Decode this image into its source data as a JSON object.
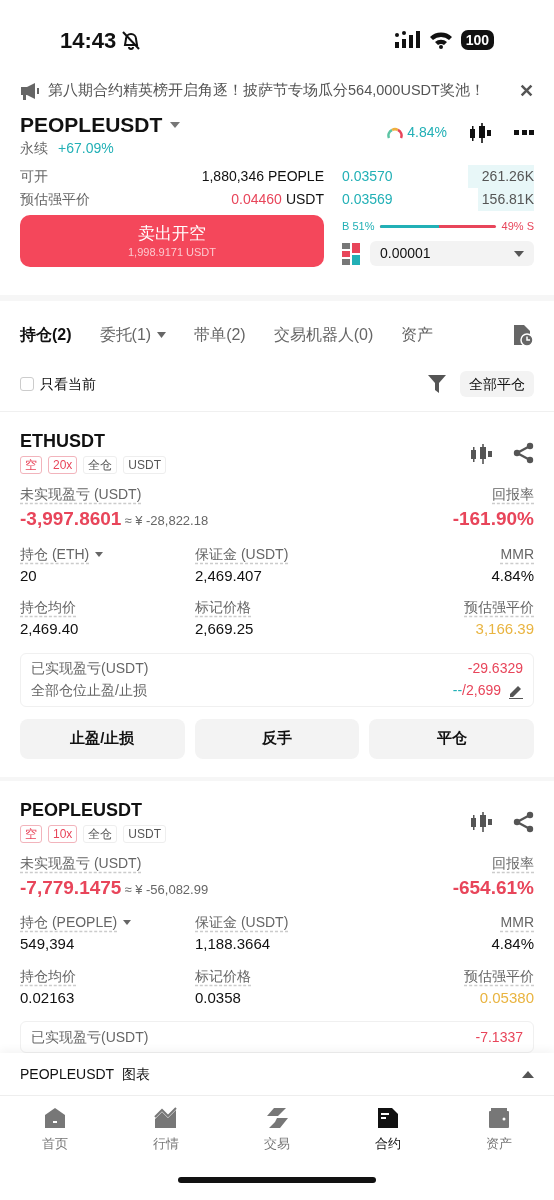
{
  "status_bar": {
    "time": "14:43",
    "battery": "100"
  },
  "banner": {
    "text": "第八期合约精英榜开启角逐！披萨节专场瓜分564,000USDT奖池！",
    "close": "✕"
  },
  "header": {
    "symbol": "PEOPLEUSDT",
    "type": "永续",
    "change": "+67.09%",
    "mmr": "4.84%"
  },
  "order_form": {
    "rows": [
      {
        "label": "可开",
        "value": "1,880,346",
        "unit": "PEOPLE",
        "color": "#111111"
      },
      {
        "label": "预估强平价",
        "value": "0.04460",
        "unit": "USDT",
        "color": "#e8455a"
      }
    ],
    "button": {
      "label": "卖出开空",
      "sub": "1,998.9171 USDT"
    }
  },
  "order_book": {
    "asks": [
      {
        "price": "0.03570",
        "amount": "261.26K"
      },
      {
        "price": "0.03569",
        "amount": "156.81K"
      }
    ],
    "buy_label": "B 51%",
    "sell_label": "49% S",
    "ratio": {
      "level": 0.51
    },
    "precision": "0.00001"
  },
  "tabs": [
    {
      "label": "持仓(2)",
      "selected": true,
      "dropdown": false
    },
    {
      "label": "委托(1)",
      "selected": false,
      "dropdown": true
    },
    {
      "label": "带单(2)",
      "selected": false,
      "dropdown": false
    },
    {
      "label": "交易机器人(0)",
      "selected": false,
      "dropdown": false
    },
    {
      "label": "资产",
      "selected": false,
      "dropdown": false
    }
  ],
  "filter": {
    "label": "只看当前",
    "checked": false,
    "close_all": "全部平仓"
  },
  "positions": [
    {
      "symbol": "ETHUSDT",
      "tags": [
        {
          "text": "空",
          "kind": "side"
        },
        {
          "text": "20x",
          "kind": "leverage"
        },
        {
          "text": "全仓",
          "kind": "plain"
        },
        {
          "text": "USDT",
          "kind": "plain"
        }
      ],
      "pnl_label": "未实现盈亏 (USDT)",
      "pnl": "-3,997.8601",
      "pnl_cny": "≈ ¥ -28,822.18",
      "roe_label": "回报率",
      "roe": "-161.90%",
      "fields": [
        {
          "label": "持仓 (ETH)",
          "value": "20",
          "color": "#111111",
          "dropdown": true
        },
        {
          "label": "保证金 (USDT)",
          "value": "2,469.407",
          "color": "#111111",
          "dropdown": false
        },
        {
          "label": "MMR",
          "value": "4.84%",
          "color": "#111111",
          "dropdown": false
        },
        {
          "label": "持仓均价",
          "value": "2,469.40",
          "color": "#111111",
          "dropdown": false
        },
        {
          "label": "标记价格",
          "value": "2,669.25",
          "color": "#111111",
          "dropdown": false
        },
        {
          "label": "预估强平价",
          "value": "3,166.39",
          "color": "#e9b440",
          "dropdown": false
        }
      ],
      "summary": [
        {
          "label": "已实现盈亏(USDT)",
          "parts": [
            {
              "text": "-29.6329",
              "color": "#e8455a"
            }
          ],
          "editable": false
        },
        {
          "label": "全部仓位止盈/止损",
          "parts": [
            {
              "text": "--",
              "color": "#22b0b6"
            },
            {
              "text": "/2,699",
              "color": "#e8455a"
            }
          ],
          "editable": true
        }
      ],
      "buttons": [
        "止盈/止损",
        "反手",
        "平仓"
      ]
    },
    {
      "symbol": "PEOPLEUSDT",
      "tags": [
        {
          "text": "空",
          "kind": "side"
        },
        {
          "text": "10x",
          "kind": "leverage"
        },
        {
          "text": "全仓",
          "kind": "plain"
        },
        {
          "text": "USDT",
          "kind": "plain"
        }
      ],
      "pnl_label": "未实现盈亏 (USDT)",
      "pnl": "-7,779.1475",
      "pnl_cny": "≈ ¥ -56,082.99",
      "roe_label": "回报率",
      "roe": "-654.61%",
      "fields": [
        {
          "label": "持仓 (PEOPLE)",
          "value": "549,394",
          "color": "#111111",
          "dropdown": true
        },
        {
          "label": "保证金 (USDT)",
          "value": "1,188.3664",
          "color": "#111111",
          "dropdown": false
        },
        {
          "label": "MMR",
          "value": "4.84%",
          "color": "#111111",
          "dropdown": false
        },
        {
          "label": "持仓均价",
          "value": "0.02163",
          "color": "#111111",
          "dropdown": false
        },
        {
          "label": "标记价格",
          "value": "0.0358",
          "color": "#111111",
          "dropdown": false
        },
        {
          "label": "预估强平价",
          "value": "0.05380",
          "color": "#e9b440",
          "dropdown": false
        }
      ],
      "summary": [
        {
          "label": "已实现盈亏(USDT)",
          "parts": [
            {
              "text": "-7.1337",
              "color": "#e8455a"
            }
          ],
          "editable": false
        }
      ]
    }
  ],
  "chart_bar": {
    "label": "PEOPLEUSDT  图表"
  },
  "bottom_nav": [
    {
      "label": "首页",
      "selected": false
    },
    {
      "label": "行情",
      "selected": false
    },
    {
      "label": "交易",
      "selected": false
    },
    {
      "label": "合约",
      "selected": true
    },
    {
      "label": "资产",
      "selected": false
    }
  ]
}
